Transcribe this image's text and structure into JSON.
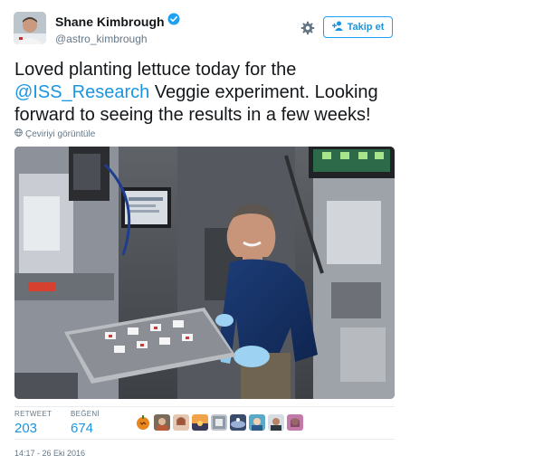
{
  "tweet": {
    "author_name": "Shane Kimbrough",
    "author_handle": "@astro_kimbrough",
    "follow_label": "Takip et",
    "text_part1": "Loved planting lettuce today for the ",
    "mention": "@ISS_Research",
    "text_part2": " Veggie experiment. Looking forward to seeing the results in a few weeks!",
    "translate_label": "Çeviriyi görüntüle",
    "timestamp": "14:17 - 26 Eki 2016"
  },
  "stats": {
    "retweet_label": "RETWEET",
    "retweet_count": "203",
    "like_label": "BEĞENİ",
    "like_count": "674"
  },
  "icons": {
    "verified": "verified-badge-icon",
    "settings": "gear-icon",
    "follow": "add-user-icon",
    "translate": "globe-icon"
  },
  "colors": {
    "accent": "#1b95e0",
    "text": "#14171a",
    "muted": "#657786",
    "border": "#e6ecf0"
  }
}
